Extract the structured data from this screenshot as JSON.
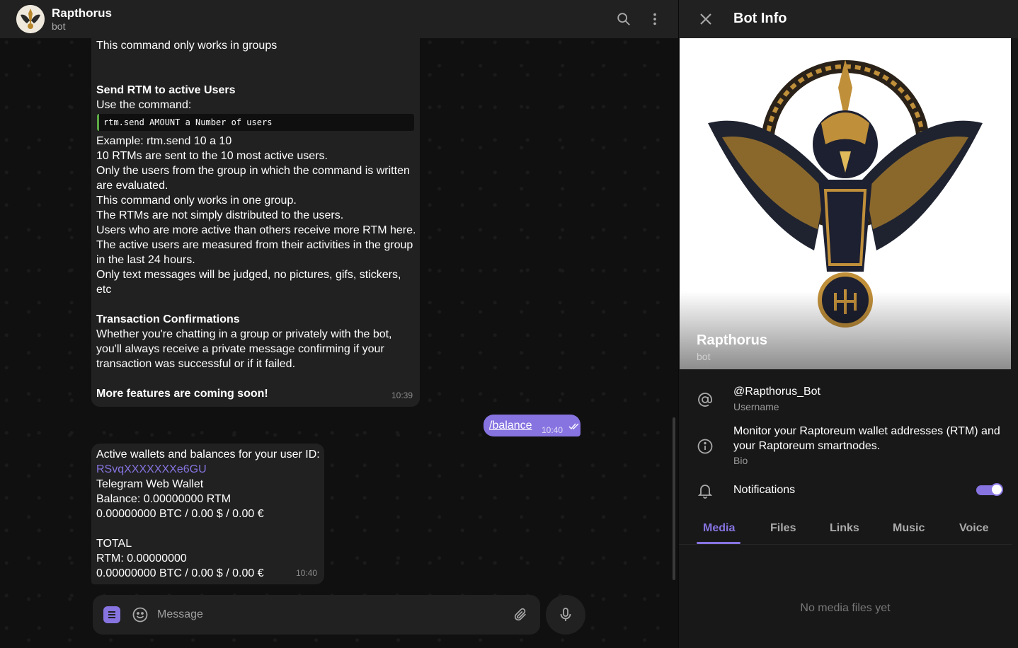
{
  "chat": {
    "title": "Rapthorus",
    "subtitle": "bot",
    "composer_placeholder": "Message"
  },
  "messages": {
    "m1": {
      "l0": "This command only works in groups",
      "l1": "Send RTM to active Users",
      "l2": "Use the command:",
      "code": "rtm.send AMOUNT a Number of users",
      "l3": "Example: rtm.send 10 a 10",
      "l4": "10 RTMs are sent to the 10 most active users.",
      "l5": "Only the users from the group in which the command is written",
      "l6": "are evaluated.",
      "l7": "This command only works in one group.",
      "l8": "The RTMs are not simply distributed to the users.",
      "l9": "Users who are more active than others receive more RTM here.",
      "l10": "The active users are measured from their activities in the group",
      "l11": "in the last 24 hours.",
      "l12": "Only text messages will be judged, no pictures, gifs, stickers,",
      "l13": "etc",
      "l14": "Transaction Confirmations",
      "l15": "Whether you're chatting in a group or privately with the bot,",
      "l16": "you'll always receive a private message confirming if your",
      "l17": "transaction was successful or if it failed.",
      "l18": "More features are coming soon!",
      "time": "10:39"
    },
    "m2": {
      "text": "/balance",
      "time": "10:40"
    },
    "m3": {
      "l0": "Active wallets and balances for your user ID:",
      "address": "RSvqXXXXXXXe6GU",
      "l1": "Telegram Web Wallet",
      "l2": "Balance: 0.00000000 RTM",
      "l3": "0.00000000 BTC / 0.00 $ / 0.00 €",
      "l4": "TOTAL",
      "l5": "RTM: 0.00000000",
      "l6": "0.00000000 BTC / 0.00 $ / 0.00 €",
      "time": "10:40"
    }
  },
  "panel": {
    "title": "Bot Info",
    "name": "Rapthorus",
    "subtitle": "bot",
    "username": "@Rapthorus_Bot",
    "username_caption": "Username",
    "bio_line1": "Monitor your Raptoreum wallet addresses (RTM) and",
    "bio_line2": "your Raptoreum smartnodes.",
    "bio_caption": "Bio",
    "notifications_label": "Notifications",
    "notifications_on": true,
    "tabs": [
      "Media",
      "Files",
      "Links",
      "Music",
      "Voice"
    ],
    "active_tab": "Media",
    "empty_text": "No media files yet"
  },
  "colors": {
    "accent": "#8774e1",
    "bubble": "#212121",
    "code_border": "#5ba844"
  },
  "icons": {
    "search": "search-icon",
    "more": "more-vertical-icon",
    "close": "close-icon",
    "username": "at-sign-icon",
    "bio": "info-icon",
    "notifications": "bell-icon",
    "emoji": "smile-icon",
    "attach": "paperclip-icon",
    "mic": "microphone-icon",
    "bot_menu": "bot-menu-icon"
  }
}
